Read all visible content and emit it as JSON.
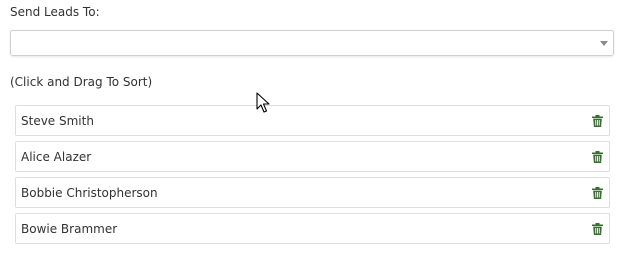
{
  "form": {
    "send_leads_label": "Send Leads To:",
    "select_value": "",
    "sort_hint": "(Click and Drag To Sort)"
  },
  "leads": [
    {
      "name": "Steve Smith",
      "icon": "trash-icon"
    },
    {
      "name": "Alice Alazer",
      "icon": "trash-icon"
    },
    {
      "name": "Bobbie Christopherson",
      "icon": "trash-icon"
    },
    {
      "name": "Bowie Brammer",
      "icon": "trash-icon"
    }
  ],
  "colors": {
    "trash_icon": "#3d6b35",
    "border": "#dedede",
    "text": "#333333"
  }
}
